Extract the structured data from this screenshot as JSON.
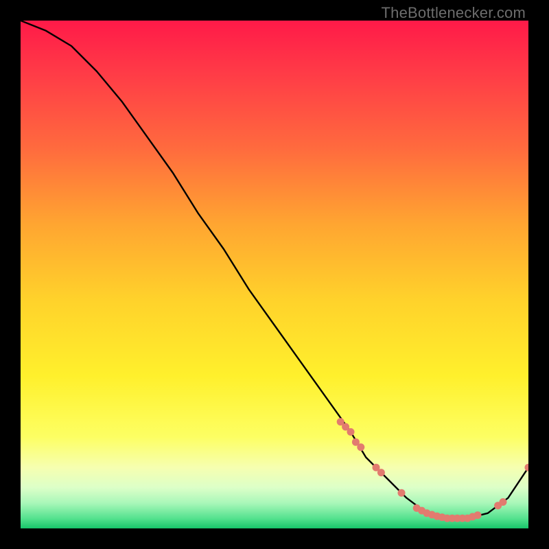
{
  "attribution": "TheBottlenecker.com",
  "chart_data": {
    "type": "line",
    "title": "",
    "xlabel": "",
    "ylabel": "",
    "xlim": [
      0,
      100
    ],
    "ylim": [
      0,
      100
    ],
    "series": [
      {
        "name": "bottleneck-curve",
        "x": [
          0,
          5,
          10,
          15,
          20,
          25,
          30,
          35,
          40,
          45,
          50,
          55,
          60,
          65,
          68,
          72,
          76,
          80,
          84,
          88,
          92,
          96,
          100
        ],
        "y": [
          100,
          98,
          95,
          90,
          84,
          77,
          70,
          62,
          55,
          47,
          40,
          33,
          26,
          19,
          14,
          10,
          6,
          3,
          2,
          2,
          3,
          6,
          12
        ]
      }
    ],
    "markers": {
      "name": "highlight-dots",
      "color": "#e27b6f",
      "points": [
        {
          "x": 63,
          "y": 21
        },
        {
          "x": 64,
          "y": 20
        },
        {
          "x": 65,
          "y": 19
        },
        {
          "x": 66,
          "y": 17
        },
        {
          "x": 67,
          "y": 16
        },
        {
          "x": 70,
          "y": 12
        },
        {
          "x": 71,
          "y": 11
        },
        {
          "x": 75,
          "y": 7
        },
        {
          "x": 78,
          "y": 4
        },
        {
          "x": 79,
          "y": 3.5
        },
        {
          "x": 80,
          "y": 3
        },
        {
          "x": 81,
          "y": 2.7
        },
        {
          "x": 82,
          "y": 2.4
        },
        {
          "x": 83,
          "y": 2.2
        },
        {
          "x": 84,
          "y": 2.0
        },
        {
          "x": 85,
          "y": 2.0
        },
        {
          "x": 86,
          "y": 2.0
        },
        {
          "x": 87,
          "y": 2.0
        },
        {
          "x": 88,
          "y": 2.0
        },
        {
          "x": 89,
          "y": 2.3
        },
        {
          "x": 90,
          "y": 2.6
        },
        {
          "x": 94,
          "y": 4.5
        },
        {
          "x": 95,
          "y": 5.2
        },
        {
          "x": 100,
          "y": 12
        }
      ]
    }
  }
}
